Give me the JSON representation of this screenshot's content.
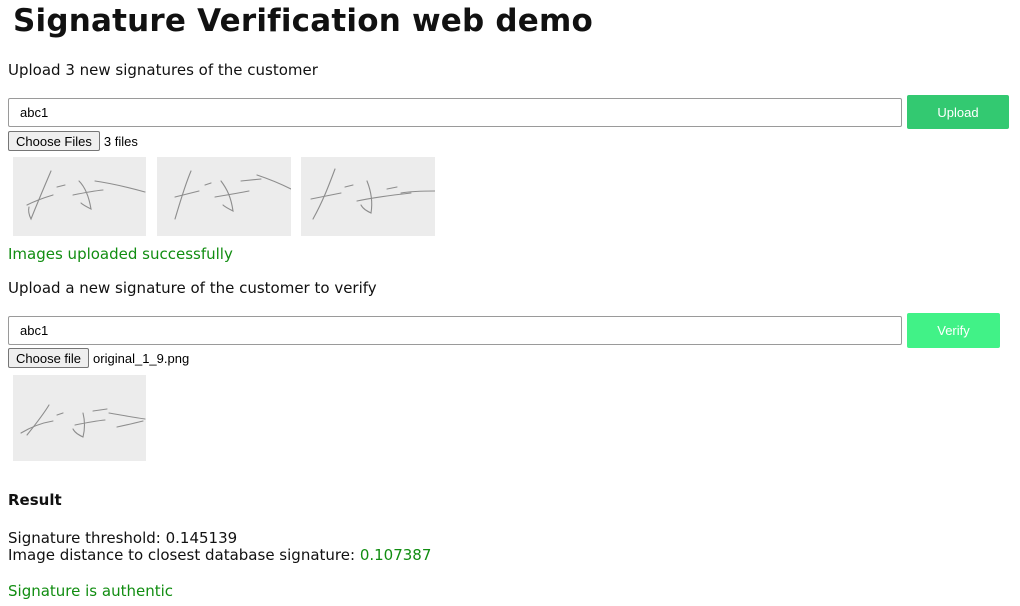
{
  "page": {
    "title": "Signature Verification web demo"
  },
  "upload_section": {
    "instruction": "Upload 3 new signatures of the customer",
    "customer_id_value": "abc1",
    "upload_button_label": "Upload",
    "choose_files_label": "Choose Files",
    "file_status": "3 files",
    "status_message": "Images uploaded successfully"
  },
  "verify_section": {
    "instruction": "Upload a new signature of the customer to verify",
    "customer_id_value": "abc1",
    "verify_button_label": "Verify",
    "choose_file_label": "Choose file",
    "file_status": "original_1_9.png"
  },
  "result": {
    "heading": "Result",
    "threshold_label": "Signature threshold:",
    "threshold_value": "0.145139",
    "distance_label": "Image distance to closest database signature:",
    "distance_value": "0.107387",
    "verdict": "Signature is authentic"
  },
  "colors": {
    "upload_button": "#33c971",
    "verify_button": "#41f287",
    "success_text": "#118d11"
  }
}
